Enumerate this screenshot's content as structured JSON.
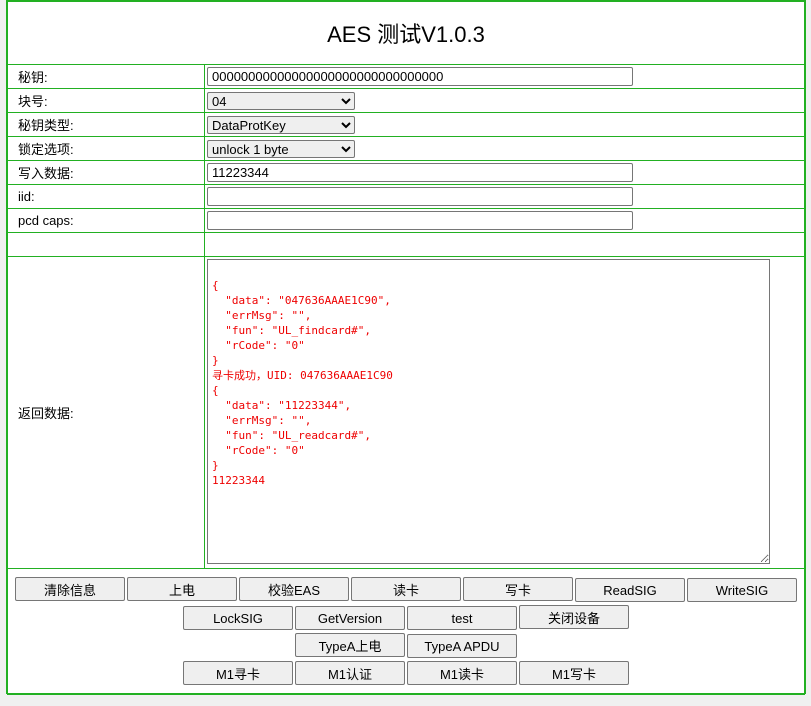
{
  "title": "AES 测试V1.0.3",
  "fields": {
    "key": {
      "label": "秘钥:",
      "value": "00000000000000000000000000000000"
    },
    "block": {
      "label": "块号:",
      "value": "04"
    },
    "key_type": {
      "label": "秘钥类型:",
      "value": "DataProtKey"
    },
    "lock": {
      "label": "锁定选项:",
      "value": "unlock 1 byte"
    },
    "write_data": {
      "label": "写入数据:",
      "value": "11223344"
    },
    "iid": {
      "label": "iid:",
      "value": ""
    },
    "pcd_caps": {
      "label": "pcd caps:",
      "value": ""
    }
  },
  "return": {
    "label": "返回数据:",
    "value": "\n{\n  \"data\": \"047636AAAE1C90\",\n  \"errMsg\": \"\",\n  \"fun\": \"UL_findcard#\",\n  \"rCode\": \"0\"\n}\n寻卡成功，UID: 047636AAAE1C90\n{\n  \"data\": \"11223344\",\n  \"errMsg\": \"\",\n  \"fun\": \"UL_readcard#\",\n  \"rCode\": \"0\"\n}\n11223344"
  },
  "buttons": {
    "row1": [
      "清除信息",
      "上电",
      "校验EAS",
      "读卡",
      "写卡",
      "ReadSIG",
      "WriteSIG"
    ],
    "row2": [
      "LockSIG",
      "GetVersion",
      "test",
      "关闭设备"
    ],
    "row3": [
      "TypeA上电",
      "TypeA APDU"
    ],
    "row4": [
      "M1寻卡",
      "M1认证",
      "M1读卡",
      "M1写卡"
    ]
  }
}
